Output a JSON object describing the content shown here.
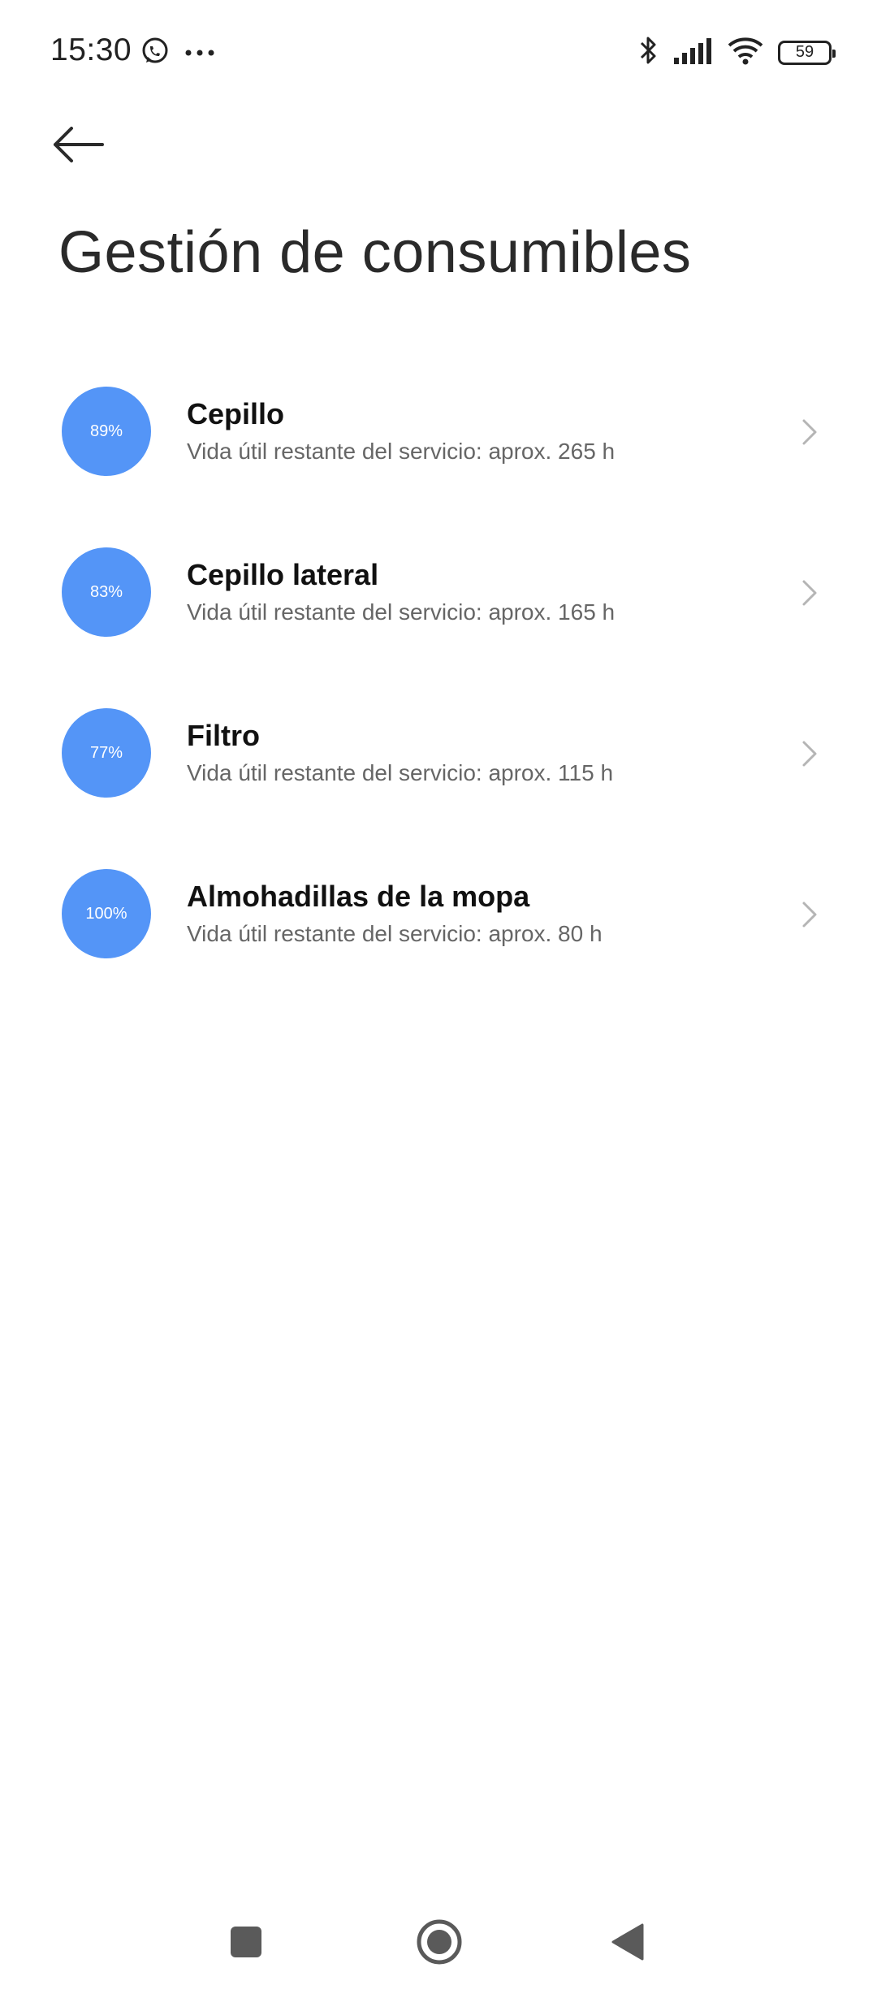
{
  "status_bar": {
    "time": "15:30",
    "battery_level": "59",
    "icons": [
      "whatsapp-icon",
      "more-dots-icon",
      "bluetooth-icon",
      "signal-icon",
      "wifi-icon",
      "battery-icon"
    ]
  },
  "header": {
    "title": "Gestión de consumibles"
  },
  "consumables": [
    {
      "percent_label": "89%",
      "name": "Cepillo",
      "detail": "Vida útil restante del servicio: aprox. 265 h"
    },
    {
      "percent_label": "83%",
      "name": "Cepillo lateral",
      "detail": "Vida útil restante del servicio: aprox. 165 h"
    },
    {
      "percent_label": "77%",
      "name": "Filtro",
      "detail": "Vida útil restante del servicio: aprox. 115 h"
    },
    {
      "percent_label": "100%",
      "name": "Almohadillas de la mopa",
      "detail": "Vida útil restante del servicio: aprox. 80 h"
    }
  ],
  "colors": {
    "accent": "#5495f7",
    "title_text": "#2a2a2a",
    "secondary_text": "#666666"
  },
  "nav_bar": {
    "buttons": [
      "recents-square-icon",
      "home-circle-icon",
      "back-triangle-icon"
    ]
  }
}
